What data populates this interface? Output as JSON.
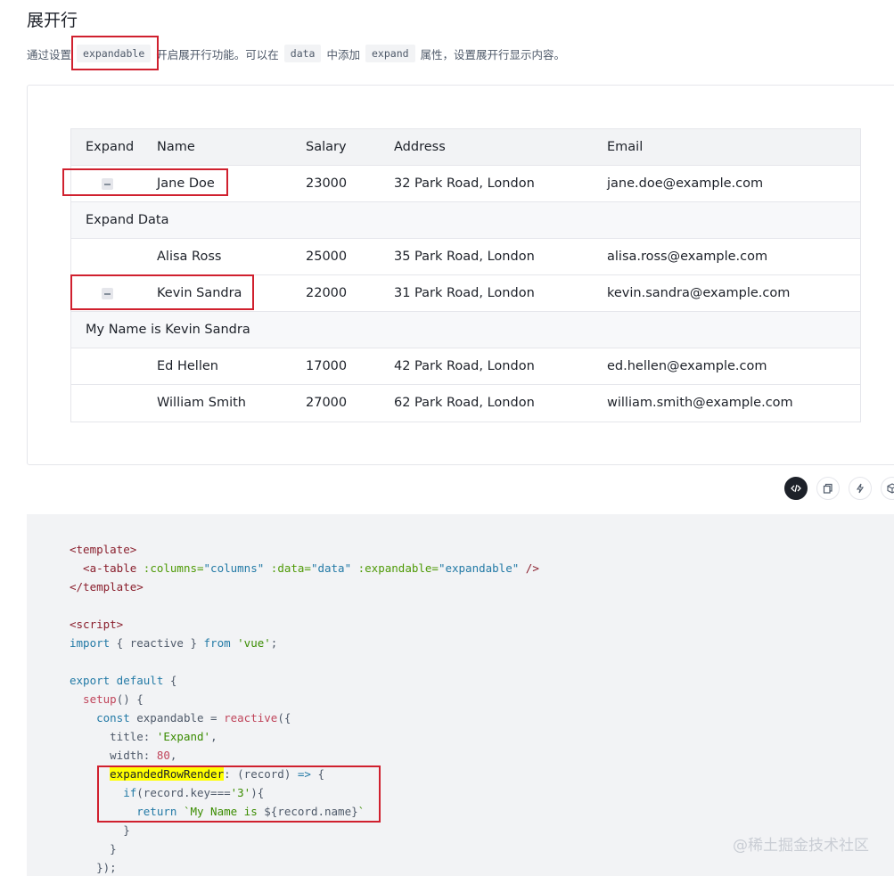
{
  "section": {
    "title": "展开行",
    "desc_prefix": "通过设置",
    "desc_code1": "expandable",
    "desc_middle": "开启展开行功能。可以在",
    "desc_code2": "data",
    "desc_middle2": "中添加",
    "desc_code3": "expand",
    "desc_suffix": "属性，设置展开行显示内容。"
  },
  "table": {
    "headers": [
      "Expand",
      "Name",
      "Salary",
      "Address",
      "Email"
    ],
    "rows": [
      {
        "name": "Jane Doe",
        "salary": "23000",
        "address": "32 Park Road, London",
        "email": "jane.doe@example.com",
        "expanded": true
      },
      {
        "expand_text": "Expand Data"
      },
      {
        "name": "Alisa Ross",
        "salary": "25000",
        "address": "35 Park Road, London",
        "email": "alisa.ross@example.com",
        "expanded": false
      },
      {
        "name": "Kevin Sandra",
        "salary": "22000",
        "address": "31 Park Road, London",
        "email": "kevin.sandra@example.com",
        "expanded": true
      },
      {
        "expand_text": "My Name is Kevin Sandra"
      },
      {
        "name": "Ed Hellen",
        "salary": "17000",
        "address": "42 Park Road, London",
        "email": "ed.hellen@example.com",
        "expanded": false
      },
      {
        "name": "William Smith",
        "salary": "27000",
        "address": "62 Park Road, London",
        "email": "william.smith@example.com",
        "expanded": false
      }
    ]
  },
  "toolbar": {
    "icons": [
      "code-icon",
      "copy-icon",
      "lightning-icon",
      "codesandbox-icon"
    ]
  },
  "code": {
    "l1": "<template>",
    "l2_a": "  <a-table ",
    "l2_b": ":columns=",
    "l2_c": "\"columns\"",
    "l2_d": " :data=",
    "l2_e": "\"data\"",
    "l2_f": " :expandable=",
    "l2_g": "\"expandable\"",
    "l2_h": " />",
    "l3": "</template>",
    "l5": "<script>",
    "l6_a": "import",
    "l6_b": " { reactive } ",
    "l6_c": "from",
    "l6_d": " 'vue'",
    "l6_e": ";",
    "l8_a": "export default",
    "l8_b": " {",
    "l9_a": "  setup",
    "l9_b": "() {",
    "l10_a": "    const",
    "l10_b": " expandable = ",
    "l10_c": "reactive",
    "l10_d": "({",
    "l11_a": "      title: ",
    "l11_b": "'Expand'",
    "l11_c": ",",
    "l12_a": "      width: ",
    "l12_b": "80",
    "l12_c": ",",
    "l13_pre": "      ",
    "l13_a": "expandedRowRender",
    "l13_b": ": (record) ",
    "l13_c": "=>",
    "l13_d": " {",
    "l14_a": "        if",
    "l14_b": "(record.key===",
    "l14_c": "'3'",
    "l14_d": "){",
    "l15_a": "          return",
    "l15_b": " `My Name is ",
    "l15_c": "${record.name}",
    "l15_d": "`",
    "l16": "        }",
    "l17": "      }",
    "l18": "    });"
  },
  "watermark": "@稀土掘金技术社区",
  "colors": {
    "highlight_border": "#d0202e",
    "code_bg": "#f2f3f5",
    "table_header_bg": "#f2f3f5"
  }
}
